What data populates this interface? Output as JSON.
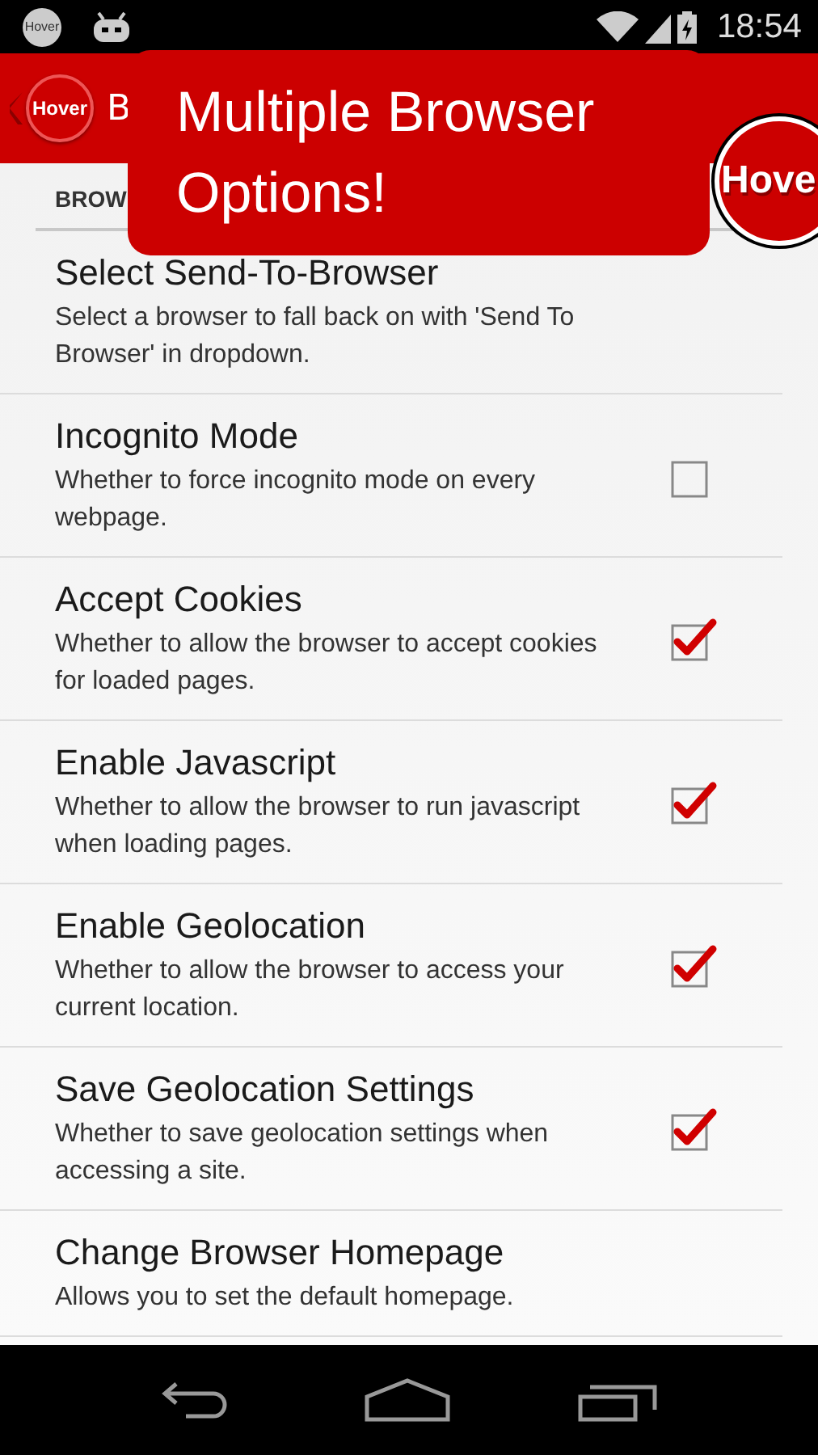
{
  "status_bar": {
    "app_badge": "Hover",
    "time": "18:54"
  },
  "action_bar": {
    "logo": "Hover",
    "title": "B"
  },
  "section_header": "BROW",
  "settings": [
    {
      "kind": "plain",
      "title": "Select Send-To-Browser",
      "description": "Select a browser to fall back on with 'Send To Browser' in dropdown."
    },
    {
      "kind": "checkbox",
      "title": "Incognito Mode",
      "description": "Whether to force incognito mode on every webpage.",
      "checked": false
    },
    {
      "kind": "checkbox",
      "title": "Accept Cookies",
      "description": "Whether to allow the browser to accept cookies for loaded pages.",
      "checked": true
    },
    {
      "kind": "checkbox",
      "title": "Enable Javascript",
      "description": "Whether to allow the browser to run javascript when loading pages.",
      "checked": true
    },
    {
      "kind": "checkbox",
      "title": "Enable Geolocation",
      "description": "Whether to allow the browser to access your current location.",
      "checked": true
    },
    {
      "kind": "checkbox",
      "title": "Save Geolocation Settings",
      "description": "Whether to save geolocation settings when accessing a site.",
      "checked": true
    },
    {
      "kind": "plain",
      "title": "Change Browser Homepage",
      "description": "Allows you to set the default homepage."
    }
  ],
  "tooltip": {
    "text": "Multiple Browser Options!"
  },
  "floating_bubble": {
    "label": "Hove"
  }
}
